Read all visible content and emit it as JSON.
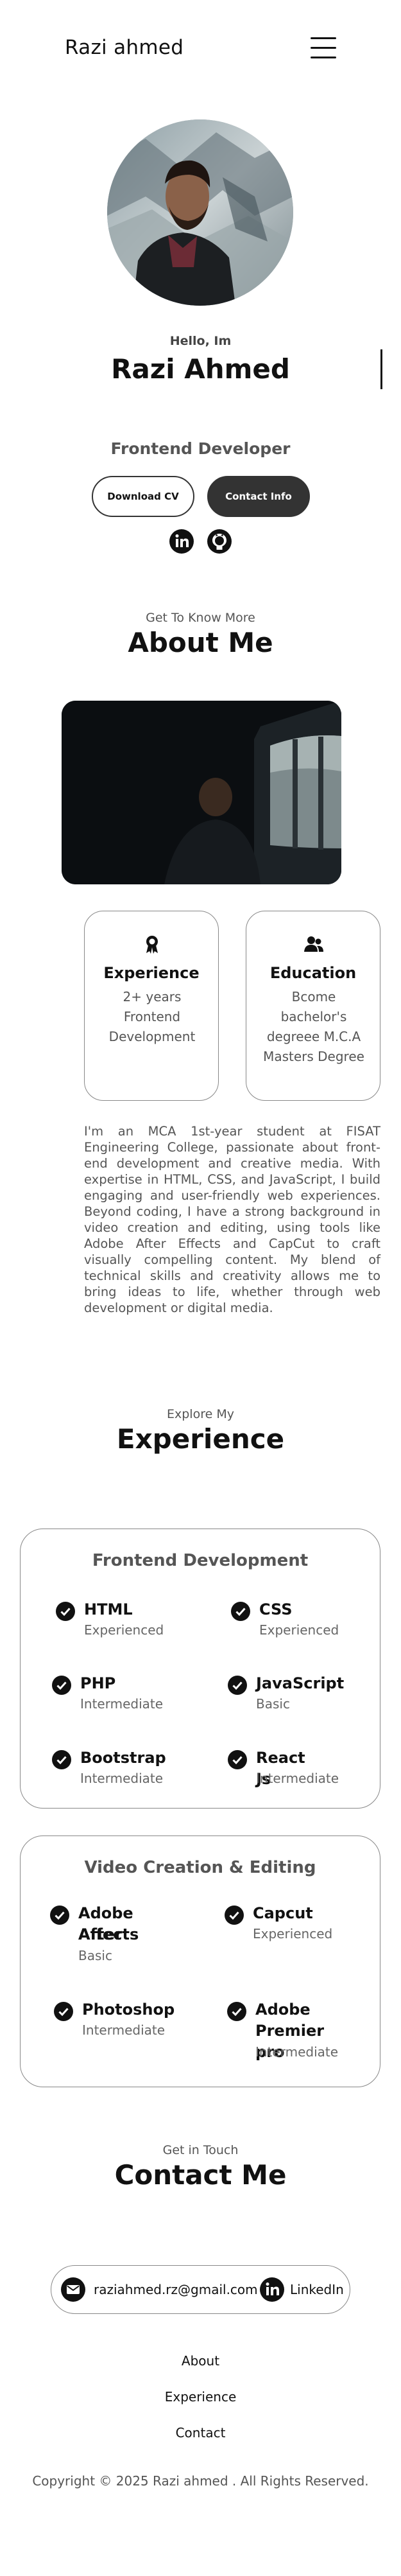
{
  "header": {
    "logo": "Razi ahmed",
    "menu_icon": "hamburger-menu-icon"
  },
  "hero": {
    "greeting": "Hello, Im",
    "name": "Razi Ahmed",
    "role": "Frontend Developer",
    "download_cv": "Download CV",
    "contact_info": "Contact Info",
    "social_icons": [
      "linkedin-icon",
      "github-icon"
    ]
  },
  "about": {
    "subtitle": "Get To Know More",
    "title": "About Me",
    "experience": {
      "icon": "award-icon",
      "heading": "Experience",
      "text": "2+ years Frontend Development"
    },
    "education": {
      "icon": "users-icon",
      "heading": "Education",
      "text": "Bcome bachelor's degreee M.C.A Masters Degree"
    },
    "description": "I'm an MCA 1st-year student at FISAT Engineering College, passionate about front-end development and creative media. With expertise in HTML, CSS, and JavaScript, I build engaging and user-friendly web experiences. Beyond coding, I have a strong background in video creation and editing, using tools like Adobe After Effects and CapCut to craft visually compelling content. My blend of technical skills and creativity allows me to bring ideas to life, whether through web development or digital media."
  },
  "experience": {
    "subtitle": "Explore My",
    "title": "Experience",
    "frontend": {
      "heading": "Frontend Development",
      "skills": [
        {
          "name": "HTML",
          "level": "Experienced"
        },
        {
          "name": "CSS",
          "level": "Experienced"
        },
        {
          "name": "PHP",
          "level": "Intermediate"
        },
        {
          "name": "JavaScript",
          "level": "Basic"
        },
        {
          "name": "Bootstrap",
          "level": "Intermediate"
        },
        {
          "name": "React Js",
          "level": "Intermediate"
        }
      ]
    },
    "video": {
      "heading": "Video Creation & Editing",
      "skills": [
        {
          "name_line1": "Adobe After",
          "name_line2": "Affects",
          "level": "Basic"
        },
        {
          "name_line1": "Capcut",
          "name_line2": "",
          "level": "Experienced"
        },
        {
          "name_line1": "Photoshop",
          "name_line2": "",
          "level": "Intermediate"
        },
        {
          "name_line1": "Adobe",
          "name_line2": "Premier pro",
          "level": "Intermediate"
        }
      ]
    }
  },
  "contact": {
    "subtitle": "Get in Touch",
    "title": "Contact Me",
    "email": "raziahmed.rz@gmail.com",
    "linkedin": "LinkedIn"
  },
  "footer": {
    "links": [
      "About",
      "Experience",
      "Contact"
    ],
    "copyright": "Copyright © 2025 Razi ahmed . All Rights Reserved."
  }
}
